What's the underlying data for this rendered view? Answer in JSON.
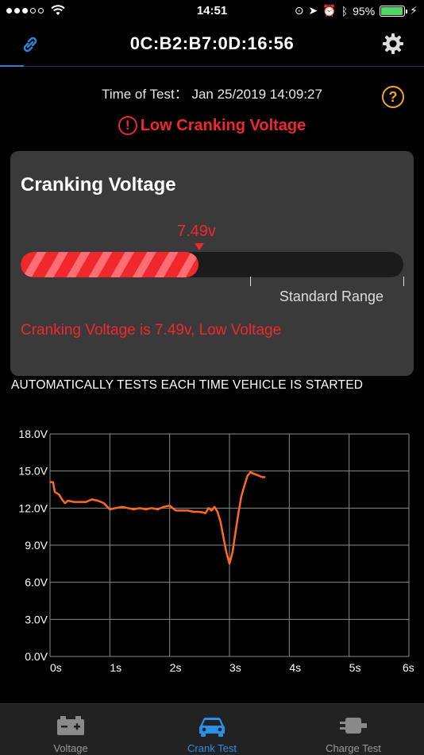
{
  "status_bar": {
    "time": "14:51",
    "battery_text": "95%",
    "battery_level": 0.95
  },
  "nav": {
    "title": "0C:B2:B7:0D:16:56",
    "left_icon": "link-icon",
    "right_icon": "gear-icon"
  },
  "test": {
    "time_label": "Time of Test：",
    "time_value": "Jan 25/2019 14:09:27",
    "alert": "Low Cranking Voltage",
    "help_icon": "?"
  },
  "card": {
    "title": "Cranking Voltage",
    "value_label": "7.49v",
    "fill_fraction": 0.465,
    "range_label": "Standard Range",
    "message": "Cranking Voltage is 7.49v, Low Voltage"
  },
  "note": "AUTOMATICALLY TESTS EACH TIME VEHICLE IS STARTED",
  "chart_data": {
    "type": "line",
    "title": "",
    "xlabel": "",
    "ylabel": "",
    "x_ticks": [
      "0s",
      "1s",
      "2s",
      "3s",
      "4s",
      "5s",
      "6s"
    ],
    "y_ticks": [
      "0.0V",
      "3.0V",
      "6.0V",
      "9.0V",
      "12.0V",
      "15.0V",
      "18.0V"
    ],
    "xlim": [
      0,
      6
    ],
    "ylim": [
      0,
      18
    ],
    "grid": true,
    "line_color": "#ff6a1f",
    "series": [
      {
        "x": [
          0,
          0.05,
          0.08,
          0.15,
          0.2,
          0.25,
          0.3,
          0.4,
          0.5,
          0.6,
          0.7,
          0.8,
          0.9,
          1.0,
          1.1,
          1.2,
          1.3,
          1.4,
          1.5,
          1.6,
          1.7,
          1.8,
          1.9,
          2.0,
          2.1,
          2.2,
          2.3,
          2.4,
          2.5,
          2.6,
          2.65,
          2.7,
          2.75,
          2.8,
          2.85,
          2.9,
          2.95,
          3.0,
          3.05,
          3.1,
          3.15,
          3.2,
          3.25,
          3.3,
          3.35,
          3.4,
          3.45,
          3.5,
          3.55,
          3.6
        ],
        "y": [
          14.1,
          14.1,
          13.3,
          13.1,
          12.7,
          12.4,
          12.6,
          12.5,
          12.5,
          12.5,
          12.7,
          12.6,
          12.4,
          11.9,
          12.0,
          12.1,
          12.0,
          11.9,
          12.0,
          11.9,
          12.0,
          11.9,
          12.1,
          12.2,
          11.8,
          11.8,
          11.8,
          11.7,
          11.7,
          11.6,
          12.0,
          11.8,
          12.1,
          11.7,
          10.9,
          9.6,
          8.4,
          7.5,
          8.4,
          10.0,
          11.6,
          13.0,
          13.8,
          14.6,
          14.9,
          14.8,
          14.7,
          14.6,
          14.5,
          14.5
        ]
      }
    ]
  },
  "tabs": [
    {
      "label": "Voltage",
      "icon": "battery-icon",
      "active": false
    },
    {
      "label": "Crank Test",
      "icon": "car-icon",
      "active": true
    },
    {
      "label": "Charge Test",
      "icon": "plug-icon",
      "active": false
    }
  ]
}
